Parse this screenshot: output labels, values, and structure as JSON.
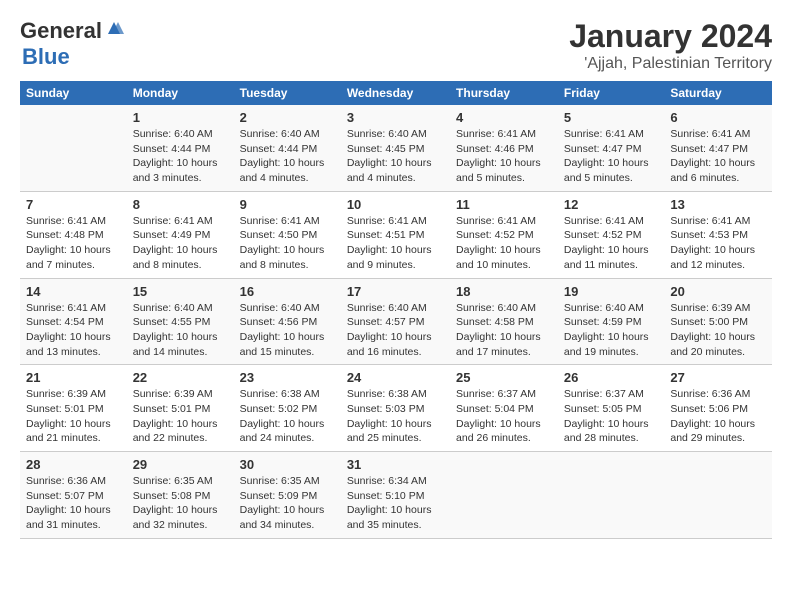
{
  "app": {
    "logo_general": "General",
    "logo_blue": "Blue"
  },
  "header": {
    "month": "January 2024",
    "location": "'Ajjah, Palestinian Territory"
  },
  "columns": [
    "Sunday",
    "Monday",
    "Tuesday",
    "Wednesday",
    "Thursday",
    "Friday",
    "Saturday"
  ],
  "weeks": [
    [
      {
        "day": "",
        "sunrise": "",
        "sunset": "",
        "daylight": ""
      },
      {
        "day": "1",
        "sunrise": "Sunrise: 6:40 AM",
        "sunset": "Sunset: 4:44 PM",
        "daylight": "Daylight: 10 hours and 3 minutes."
      },
      {
        "day": "2",
        "sunrise": "Sunrise: 6:40 AM",
        "sunset": "Sunset: 4:44 PM",
        "daylight": "Daylight: 10 hours and 4 minutes."
      },
      {
        "day": "3",
        "sunrise": "Sunrise: 6:40 AM",
        "sunset": "Sunset: 4:45 PM",
        "daylight": "Daylight: 10 hours and 4 minutes."
      },
      {
        "day": "4",
        "sunrise": "Sunrise: 6:41 AM",
        "sunset": "Sunset: 4:46 PM",
        "daylight": "Daylight: 10 hours and 5 minutes."
      },
      {
        "day": "5",
        "sunrise": "Sunrise: 6:41 AM",
        "sunset": "Sunset: 4:47 PM",
        "daylight": "Daylight: 10 hours and 5 minutes."
      },
      {
        "day": "6",
        "sunrise": "Sunrise: 6:41 AM",
        "sunset": "Sunset: 4:47 PM",
        "daylight": "Daylight: 10 hours and 6 minutes."
      }
    ],
    [
      {
        "day": "7",
        "sunrise": "Sunrise: 6:41 AM",
        "sunset": "Sunset: 4:48 PM",
        "daylight": "Daylight: 10 hours and 7 minutes."
      },
      {
        "day": "8",
        "sunrise": "Sunrise: 6:41 AM",
        "sunset": "Sunset: 4:49 PM",
        "daylight": "Daylight: 10 hours and 8 minutes."
      },
      {
        "day": "9",
        "sunrise": "Sunrise: 6:41 AM",
        "sunset": "Sunset: 4:50 PM",
        "daylight": "Daylight: 10 hours and 8 minutes."
      },
      {
        "day": "10",
        "sunrise": "Sunrise: 6:41 AM",
        "sunset": "Sunset: 4:51 PM",
        "daylight": "Daylight: 10 hours and 9 minutes."
      },
      {
        "day": "11",
        "sunrise": "Sunrise: 6:41 AM",
        "sunset": "Sunset: 4:52 PM",
        "daylight": "Daylight: 10 hours and 10 minutes."
      },
      {
        "day": "12",
        "sunrise": "Sunrise: 6:41 AM",
        "sunset": "Sunset: 4:52 PM",
        "daylight": "Daylight: 10 hours and 11 minutes."
      },
      {
        "day": "13",
        "sunrise": "Sunrise: 6:41 AM",
        "sunset": "Sunset: 4:53 PM",
        "daylight": "Daylight: 10 hours and 12 minutes."
      }
    ],
    [
      {
        "day": "14",
        "sunrise": "Sunrise: 6:41 AM",
        "sunset": "Sunset: 4:54 PM",
        "daylight": "Daylight: 10 hours and 13 minutes."
      },
      {
        "day": "15",
        "sunrise": "Sunrise: 6:40 AM",
        "sunset": "Sunset: 4:55 PM",
        "daylight": "Daylight: 10 hours and 14 minutes."
      },
      {
        "day": "16",
        "sunrise": "Sunrise: 6:40 AM",
        "sunset": "Sunset: 4:56 PM",
        "daylight": "Daylight: 10 hours and 15 minutes."
      },
      {
        "day": "17",
        "sunrise": "Sunrise: 6:40 AM",
        "sunset": "Sunset: 4:57 PM",
        "daylight": "Daylight: 10 hours and 16 minutes."
      },
      {
        "day": "18",
        "sunrise": "Sunrise: 6:40 AM",
        "sunset": "Sunset: 4:58 PM",
        "daylight": "Daylight: 10 hours and 17 minutes."
      },
      {
        "day": "19",
        "sunrise": "Sunrise: 6:40 AM",
        "sunset": "Sunset: 4:59 PM",
        "daylight": "Daylight: 10 hours and 19 minutes."
      },
      {
        "day": "20",
        "sunrise": "Sunrise: 6:39 AM",
        "sunset": "Sunset: 5:00 PM",
        "daylight": "Daylight: 10 hours and 20 minutes."
      }
    ],
    [
      {
        "day": "21",
        "sunrise": "Sunrise: 6:39 AM",
        "sunset": "Sunset: 5:01 PM",
        "daylight": "Daylight: 10 hours and 21 minutes."
      },
      {
        "day": "22",
        "sunrise": "Sunrise: 6:39 AM",
        "sunset": "Sunset: 5:01 PM",
        "daylight": "Daylight: 10 hours and 22 minutes."
      },
      {
        "day": "23",
        "sunrise": "Sunrise: 6:38 AM",
        "sunset": "Sunset: 5:02 PM",
        "daylight": "Daylight: 10 hours and 24 minutes."
      },
      {
        "day": "24",
        "sunrise": "Sunrise: 6:38 AM",
        "sunset": "Sunset: 5:03 PM",
        "daylight": "Daylight: 10 hours and 25 minutes."
      },
      {
        "day": "25",
        "sunrise": "Sunrise: 6:37 AM",
        "sunset": "Sunset: 5:04 PM",
        "daylight": "Daylight: 10 hours and 26 minutes."
      },
      {
        "day": "26",
        "sunrise": "Sunrise: 6:37 AM",
        "sunset": "Sunset: 5:05 PM",
        "daylight": "Daylight: 10 hours and 28 minutes."
      },
      {
        "day": "27",
        "sunrise": "Sunrise: 6:36 AM",
        "sunset": "Sunset: 5:06 PM",
        "daylight": "Daylight: 10 hours and 29 minutes."
      }
    ],
    [
      {
        "day": "28",
        "sunrise": "Sunrise: 6:36 AM",
        "sunset": "Sunset: 5:07 PM",
        "daylight": "Daylight: 10 hours and 31 minutes."
      },
      {
        "day": "29",
        "sunrise": "Sunrise: 6:35 AM",
        "sunset": "Sunset: 5:08 PM",
        "daylight": "Daylight: 10 hours and 32 minutes."
      },
      {
        "day": "30",
        "sunrise": "Sunrise: 6:35 AM",
        "sunset": "Sunset: 5:09 PM",
        "daylight": "Daylight: 10 hours and 34 minutes."
      },
      {
        "day": "31",
        "sunrise": "Sunrise: 6:34 AM",
        "sunset": "Sunset: 5:10 PM",
        "daylight": "Daylight: 10 hours and 35 minutes."
      },
      {
        "day": "",
        "sunrise": "",
        "sunset": "",
        "daylight": ""
      },
      {
        "day": "",
        "sunrise": "",
        "sunset": "",
        "daylight": ""
      },
      {
        "day": "",
        "sunrise": "",
        "sunset": "",
        "daylight": ""
      }
    ]
  ]
}
